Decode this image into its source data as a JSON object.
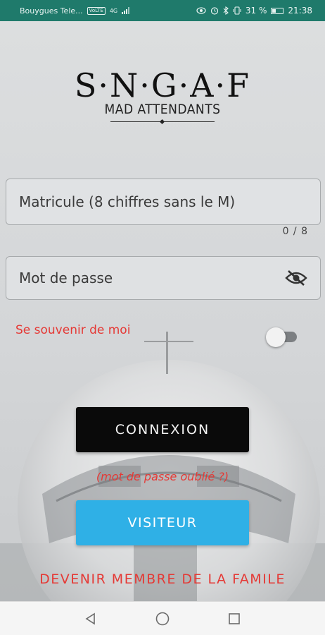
{
  "status_bar": {
    "carrier": "Bouygues Tele...",
    "network_tag": "VoLTE",
    "signal_tag": "4G",
    "battery": "31 %",
    "time": "21:38"
  },
  "logo": {
    "title": "S·N·G·A·F",
    "subtitle": "MAD ATTENDANTS"
  },
  "form": {
    "matricule_placeholder": "Matricule (8 chiffres sans le M)",
    "matricule_counter": "0 / 8",
    "password_placeholder": "Mot de passe",
    "remember_label": "Se souvenir de moi",
    "remember_on": false
  },
  "buttons": {
    "connexion": "CONNEXION",
    "forgot": "(mot de passe oublié ?)",
    "visiteur": "VISITEUR",
    "devenir": "DEVENIR MEMBRE DE LA FAMILE"
  },
  "colors": {
    "status_bar": "#1f7a6b",
    "accent_red": "#e53935",
    "primary_black": "#0a0a0a",
    "visitor_blue": "#2fb0e6"
  },
  "icons": {
    "password_toggle": "eye-off-icon",
    "nav_back": "back-triangle-icon",
    "nav_home": "home-circle-icon",
    "nav_recents": "recents-square-icon"
  }
}
